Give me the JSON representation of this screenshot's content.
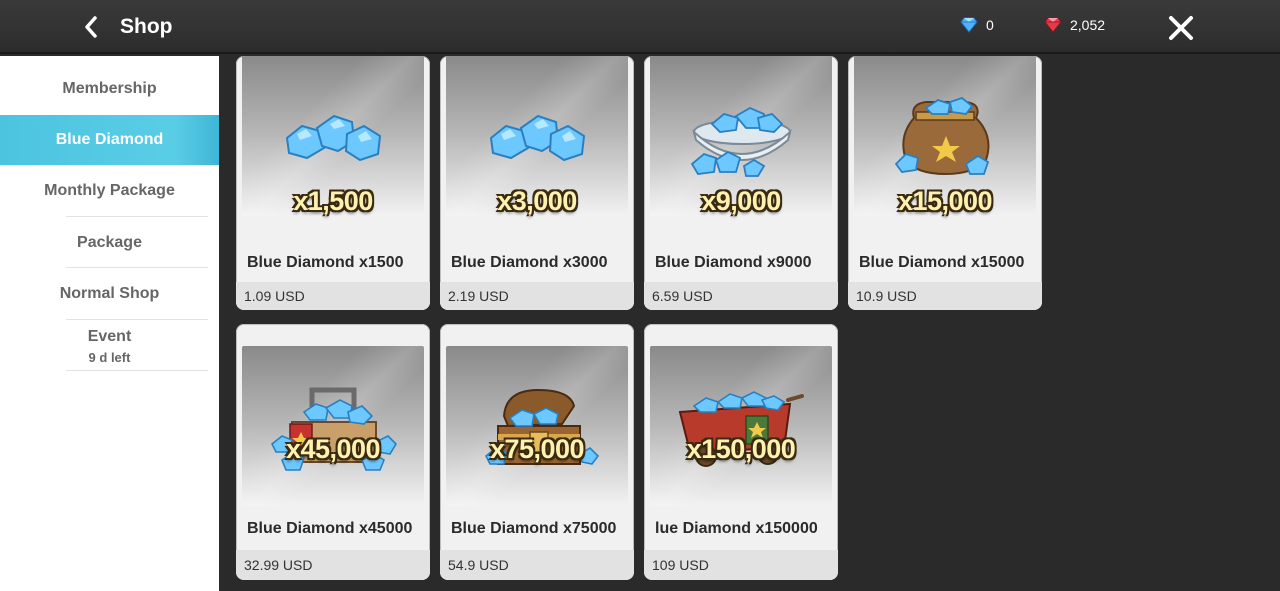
{
  "header": {
    "title": "Shop",
    "blue_diamond_count": "0",
    "red_diamond_count": "2,052"
  },
  "sidebar": {
    "items": [
      {
        "label": "Membership"
      },
      {
        "label": "Blue Diamond"
      },
      {
        "label": "Monthly Package"
      },
      {
        "label": "Package"
      },
      {
        "label": "Normal Shop"
      },
      {
        "label": "Event",
        "sub": "9 d left"
      }
    ],
    "active_color": "#4cc4e0"
  },
  "products": [
    {
      "qty": "x1,500",
      "name": "Blue Diamond x1500",
      "price": "1.09 USD",
      "icon": "diamond-pile-icon"
    },
    {
      "qty": "x3,000",
      "name": "Blue Diamond x3000",
      "price": "2.19 USD",
      "icon": "diamond-pile-icon"
    },
    {
      "qty": "x9,000",
      "name": "Blue Diamond x9000",
      "price": "6.59 USD",
      "icon": "diamond-bowl-icon"
    },
    {
      "qty": "x15,000",
      "name": "Blue Diamond x15000",
      "price": "10.9 USD",
      "icon": "diamond-sack-icon"
    },
    {
      "qty": "x45,000",
      "name": "Blue Diamond x45000",
      "price": "32.99 USD",
      "icon": "diamond-basket-icon"
    },
    {
      "qty": "x75,000",
      "name": "Blue Diamond x75000",
      "price": "54.9 USD",
      "icon": "treasure-chest-icon"
    },
    {
      "qty": "x150,000",
      "name": "lue Diamond x150000",
      "price": "109 USD",
      "icon": "diamond-cart-icon"
    }
  ]
}
